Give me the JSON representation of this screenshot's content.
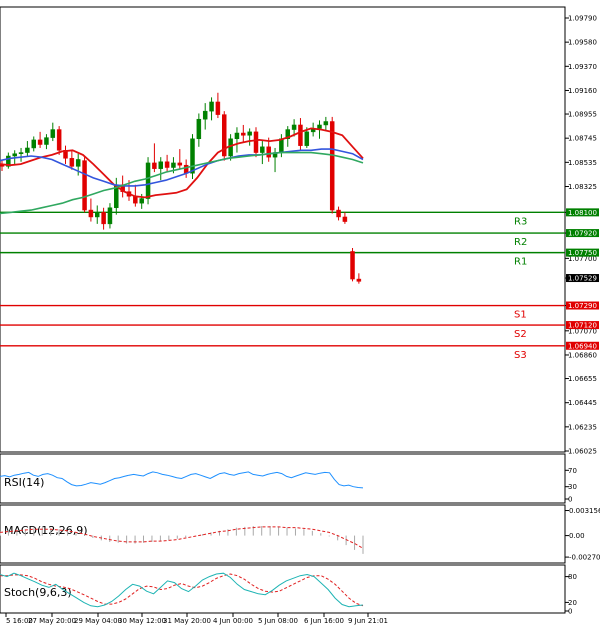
{
  "chart_data": {
    "type": "candlestick",
    "price_axis": {
      "ylim": [
        1.0595,
        1.0815
      ],
      "ticks": [
        "1.09790",
        "1.09580",
        "1.09370",
        "1.09160",
        "1.08955",
        "1.08745",
        "1.08535",
        "1.08325",
        "1.08100",
        "1.07920",
        "1.07700",
        "1.07529",
        "1.07290",
        "1.07070",
        "1.06860",
        "1.06655",
        "1.06445",
        "1.06235",
        "1.06025"
      ],
      "tick_values": [
        1.0979,
        1.0958,
        1.0937,
        1.0916,
        1.08955,
        1.08745,
        1.08535,
        1.08325,
        1.081,
        1.0792,
        1.077,
        1.07529,
        1.0729,
        1.0707,
        1.0686,
        1.06655,
        1.06445,
        1.06235,
        1.06025
      ]
    },
    "x_ticks": [
      "5 16:00",
      "27 May 20:00",
      "29 May 04:00",
      "30 May 12:00",
      "31 May 20:00",
      "4 Jun 00:00",
      "5 Jun 08:00",
      "6 Jun 16:00",
      "9 Jun 21:01"
    ],
    "current_price": {
      "label": "1.07529",
      "value": 1.07529,
      "color": "#000000"
    },
    "levels": [
      {
        "name": "R3",
        "label": "1.08100",
        "value": 1.081,
        "color": "#008000"
      },
      {
        "name": "R2",
        "label": "1.07920",
        "value": 1.0792,
        "color": "#008000"
      },
      {
        "name": "R1",
        "label": "1.07750",
        "value": 1.0775,
        "color": "#008000"
      },
      {
        "name": "S1",
        "label": "1.07290",
        "value": 1.0729,
        "color": "#e00000"
      },
      {
        "name": "S2",
        "label": "1.07120",
        "value": 1.0712,
        "color": "#e00000"
      },
      {
        "name": "S3",
        "label": "1.06940",
        "value": 1.0694,
        "color": "#e00000"
      }
    ],
    "candles": [
      [
        1.0851,
        1.0855,
        1.0846,
        1.085
      ],
      [
        1.085,
        1.0862,
        1.0848,
        1.0859
      ],
      [
        1.0859,
        1.0864,
        1.0852,
        1.0861
      ],
      [
        1.0861,
        1.0866,
        1.0854,
        1.0862
      ],
      [
        1.0862,
        1.0872,
        1.0859,
        1.0866
      ],
      [
        1.0866,
        1.0876,
        1.0863,
        1.0873
      ],
      [
        1.0873,
        1.088,
        1.0866,
        1.0869
      ],
      [
        1.0869,
        1.0878,
        1.0865,
        1.0875
      ],
      [
        1.0875,
        1.0888,
        1.0872,
        1.0882
      ],
      [
        1.0882,
        1.0885,
        1.086,
        1.0864
      ],
      [
        1.0864,
        1.0868,
        1.0852,
        1.0857
      ],
      [
        1.0857,
        1.0864,
        1.0847,
        1.085
      ],
      [
        1.085,
        1.0861,
        1.0842,
        1.0856
      ],
      [
        1.0855,
        1.0858,
        1.081,
        1.0812
      ],
      [
        1.0812,
        1.0822,
        1.0802,
        1.0806
      ],
      [
        1.0806,
        1.0816,
        1.08,
        1.081
      ],
      [
        1.081,
        1.0814,
        1.0795,
        1.08
      ],
      [
        1.08,
        1.0818,
        1.0796,
        1.0814
      ],
      [
        1.0814,
        1.084,
        1.0808,
        1.0834
      ],
      [
        1.0834,
        1.0842,
        1.0823,
        1.0828
      ],
      [
        1.0828,
        1.0838,
        1.082,
        1.0824
      ],
      [
        1.0824,
        1.0834,
        1.0815,
        1.0818
      ],
      [
        1.0818,
        1.0826,
        1.0813,
        1.0822
      ],
      [
        1.0822,
        1.0858,
        1.0817,
        1.0853
      ],
      [
        1.0853,
        1.087,
        1.0845,
        1.0848
      ],
      [
        1.0848,
        1.0858,
        1.0838,
        1.0854
      ],
      [
        1.0854,
        1.086,
        1.0845,
        1.0849
      ],
      [
        1.0849,
        1.0858,
        1.0844,
        1.0853
      ],
      [
        1.0853,
        1.0865,
        1.0848,
        1.0851
      ],
      [
        1.0851,
        1.0856,
        1.084,
        1.0844
      ],
      [
        1.0844,
        1.0878,
        1.0839,
        1.0874
      ],
      [
        1.0874,
        1.0896,
        1.0867,
        1.0891
      ],
      [
        1.0891,
        1.0905,
        1.0882,
        1.0898
      ],
      [
        1.0898,
        1.091,
        1.089,
        1.0906
      ],
      [
        1.0906,
        1.0914,
        1.0892,
        1.0895
      ],
      [
        1.0895,
        1.0898,
        1.0855,
        1.0859
      ],
      [
        1.0859,
        1.0878,
        1.0855,
        1.0874
      ],
      [
        1.0874,
        1.0884,
        1.0862,
        1.0879
      ],
      [
        1.0879,
        1.0886,
        1.0871,
        1.0877
      ],
      [
        1.0877,
        1.0883,
        1.0868,
        1.088
      ],
      [
        1.088,
        1.0884,
        1.0858,
        1.0862
      ],
      [
        1.0862,
        1.0872,
        1.0852,
        1.0867
      ],
      [
        1.0867,
        1.0875,
        1.0854,
        1.0858
      ],
      [
        1.0858,
        1.0866,
        1.0845,
        1.0862
      ],
      [
        1.0862,
        1.0878,
        1.0858,
        1.0874
      ],
      [
        1.0874,
        1.0885,
        1.0867,
        1.0882
      ],
      [
        1.0882,
        1.0891,
        1.0876,
        1.0886
      ],
      [
        1.0886,
        1.0892,
        1.0864,
        1.0868
      ],
      [
        1.0868,
        1.0884,
        1.0866,
        1.088
      ],
      [
        1.088,
        1.0888,
        1.0876,
        1.0883
      ],
      [
        1.0883,
        1.089,
        1.0874,
        1.0886
      ],
      [
        1.0886,
        1.0893,
        1.0881,
        1.0889
      ],
      [
        1.0889,
        1.0893,
        1.0809,
        1.0812
      ],
      [
        1.0812,
        1.0815,
        1.0803,
        1.0806
      ],
      [
        1.0806,
        1.081,
        1.08,
        1.0802
      ],
      [
        1.0776,
        1.0779,
        1.075,
        1.0752
      ],
      [
        1.0752,
        1.0757,
        1.0748,
        1.075
      ]
    ],
    "series": [
      {
        "color": "#e01010",
        "values": [
          1.0852,
          1.0851,
          1.0852,
          1.0855,
          1.0858,
          1.086,
          1.0863,
          1.0864,
          1.086,
          1.0852,
          1.0843,
          1.0834,
          1.0828,
          1.0824,
          1.0823,
          1.0825,
          1.0826,
          1.0827,
          1.083,
          1.084,
          1.0852,
          1.0862,
          1.0867,
          1.087,
          1.0872,
          1.0873,
          1.0872,
          1.0873,
          1.0876,
          1.088,
          1.0883,
          1.0882,
          1.088,
          1.0877,
          1.0867,
          1.0857
        ]
      },
      {
        "color": "#3355dd",
        "values": [
          1.0855,
          1.0857,
          1.0858,
          1.0859,
          1.0858,
          1.0856,
          1.0852,
          1.0848,
          1.0844,
          1.084,
          1.0837,
          1.0834,
          1.0833,
          1.0833,
          1.0834,
          1.0836,
          1.0838,
          1.0841,
          1.0844,
          1.0848,
          1.0852,
          1.0855,
          1.0857,
          1.0859,
          1.086,
          1.086,
          1.0861,
          1.0862,
          1.0863,
          1.0864,
          1.0864,
          1.0865,
          1.0865,
          1.0863,
          1.0861,
          1.0856
        ]
      },
      {
        "color": "#30a860",
        "values": [
          1.0809,
          1.081,
          1.0811,
          1.0812,
          1.0814,
          1.0816,
          1.0818,
          1.0821,
          1.0823,
          1.0826,
          1.0829,
          1.0831,
          1.0834,
          1.0837,
          1.0839,
          1.0842,
          1.0845,
          1.0847,
          1.0849,
          1.0851,
          1.0853,
          1.0855,
          1.0857,
          1.0858,
          1.0859,
          1.086,
          1.0861,
          1.0862,
          1.0862,
          1.0862,
          1.0862,
          1.0861,
          1.086,
          1.0858,
          1.0856,
          1.0853
        ]
      }
    ],
    "rsi": {
      "title": "RSI(14)",
      "levels": [
        "70",
        "30",
        "0"
      ],
      "ylim": [
        0,
        100
      ],
      "values": [
        55,
        57,
        54,
        58,
        60,
        63,
        65,
        58,
        55,
        60,
        62,
        58,
        52,
        50,
        42,
        35,
        32,
        33,
        36,
        40,
        38,
        36,
        40,
        45,
        50,
        52,
        55,
        58,
        60,
        58,
        56,
        62,
        66,
        64,
        60,
        58,
        55,
        52,
        50,
        55,
        60,
        62,
        58,
        54,
        50,
        56,
        62,
        64,
        60,
        58,
        62,
        64,
        66,
        60,
        58,
        56,
        60,
        63,
        65,
        62,
        55,
        52,
        56,
        60,
        64,
        62,
        60,
        63,
        65,
        64,
        48,
        35,
        32,
        34,
        30,
        28,
        27
      ],
      "color": "#1e90ff"
    },
    "macd": {
      "title": "MACD(12,26,9)",
      "ticks": [
        "0.003156",
        "0.00",
        "-0.002708"
      ],
      "ylim": [
        -0.0032,
        0.0036
      ],
      "histogram": [
        0.0005,
        0.0007,
        0.0006,
        0.0008,
        0.0009,
        0.001,
        0.0009,
        0.0008,
        0.0006,
        0.0003,
        0.0,
        -0.0003,
        -0.0006,
        -0.0008,
        -0.0009,
        -0.001,
        -0.001,
        -0.0009,
        -0.0008,
        -0.0007,
        -0.0006,
        -0.0004,
        -0.0002,
        0.0,
        0.0002,
        0.0004,
        0.0006,
        0.0008,
        0.001,
        0.0011,
        0.0012,
        0.0012,
        0.0012,
        0.0011,
        0.001,
        0.0009,
        0.0008,
        0.0006,
        0.0003,
        -0.0001,
        -0.0006,
        -0.0012,
        -0.0018,
        -0.0023
      ],
      "signal": [
        0.0004,
        0.0005,
        0.0006,
        0.0007,
        0.0008,
        0.0008,
        0.0008,
        0.0007,
        0.0006,
        0.0004,
        0.0002,
        -0.0001,
        -0.0003,
        -0.0005,
        -0.0007,
        -0.0008,
        -0.0008,
        -0.0008,
        -0.0007,
        -0.0007,
        -0.0006,
        -0.0005,
        -0.0003,
        -0.0001,
        0.0001,
        0.0003,
        0.0005,
        0.0006,
        0.0008,
        0.0009,
        0.001,
        0.0011,
        0.0011,
        0.0011,
        0.001,
        0.001,
        0.0009,
        0.0008,
        0.0006,
        0.0004,
        0.0,
        -0.0005,
        -0.001,
        -0.0016
      ],
      "hist_color": "#a8a8a8",
      "signal_color": "#e02020"
    },
    "stoch": {
      "title": "Stoch(9,6,3)",
      "ticks": [
        "80",
        "20",
        "0"
      ],
      "ylim": [
        0,
        100
      ],
      "main": [
        85,
        80,
        88,
        82,
        75,
        68,
        60,
        55,
        62,
        50,
        40,
        30,
        20,
        12,
        10,
        14,
        22,
        35,
        50,
        62,
        58,
        46,
        40,
        55,
        70,
        66,
        52,
        45,
        58,
        72,
        80,
        86,
        88,
        78,
        62,
        50,
        45,
        40,
        38,
        48,
        60,
        70,
        76,
        82,
        85,
        80,
        65,
        50,
        30,
        15,
        10,
        12,
        14
      ],
      "signal": [
        82,
        82,
        84,
        84,
        82,
        76,
        68,
        62,
        58,
        56,
        52,
        45,
        38,
        30,
        22,
        16,
        16,
        20,
        28,
        40,
        52,
        58,
        56,
        50,
        52,
        60,
        64,
        58,
        54,
        58,
        66,
        76,
        82,
        86,
        82,
        74,
        62,
        52,
        46,
        44,
        46,
        54,
        62,
        70,
        78,
        82,
        82,
        74,
        62,
        46,
        30,
        18,
        12
      ],
      "main_color": "#1eb4b4",
      "signal_color": "#e02020"
    }
  }
}
